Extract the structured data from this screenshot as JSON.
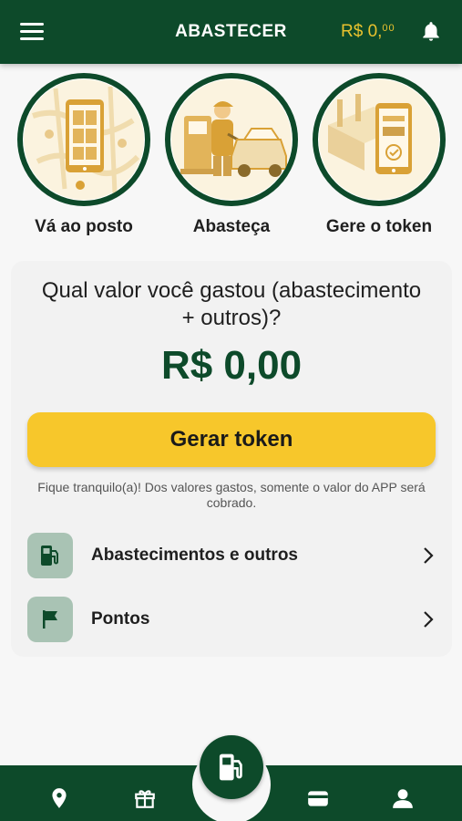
{
  "header": {
    "title": "ABASTECER",
    "balance_currency": "R$ 0,",
    "balance_cents": "00",
    "menu_icon": "menu-icon",
    "notification_icon": "bell-icon"
  },
  "steps": [
    {
      "label": "Vá ao posto",
      "illustration": "map-phone-illustration"
    },
    {
      "label": "Abasteça",
      "illustration": "fuel-pump-car-illustration"
    },
    {
      "label": "Gere o token",
      "illustration": "phone-token-illustration"
    }
  ],
  "card": {
    "question": "Qual valor você gastou (abastecimento + outros)?",
    "amount": "R$ 0,00",
    "token_button": "Gerar token",
    "note": "Fique tranquilo(a)! Dos valores gastos, somente o valor do APP será cobrado.",
    "items": [
      {
        "label": "Abastecimentos e outros",
        "icon": "fuel-pump-icon"
      },
      {
        "label": "Pontos",
        "icon": "flag-icon"
      }
    ]
  },
  "bottom_nav": {
    "items": [
      "location-pin-icon",
      "gift-icon",
      "fuel-pump-icon",
      "wallet-icon",
      "user-icon"
    ],
    "active": "fuel-pump-icon"
  },
  "colors": {
    "primary_green": "#0d4a2a",
    "accent_yellow": "#f7c72b",
    "balance_gold": "#e9c22e",
    "icon_tile": "#a9c3b4"
  }
}
